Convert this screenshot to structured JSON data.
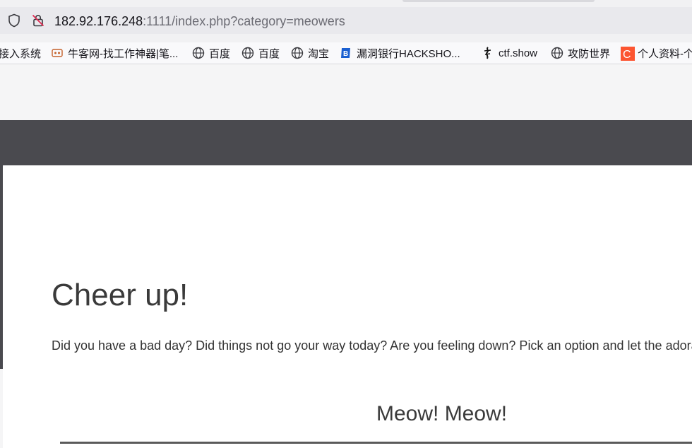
{
  "browser": {
    "url_host": "182.92.176.248",
    "url_rest": ":1111/index.php?category=meowers"
  },
  "bookmarks": [
    {
      "label": "接入系统",
      "icon": "none"
    },
    {
      "label": "牛客网-找工作神器|笔...",
      "icon": "nowcoder-icon"
    },
    {
      "label": "百度",
      "icon": "globe-icon"
    },
    {
      "label": "百度",
      "icon": "globe-icon"
    },
    {
      "label": "淘宝",
      "icon": "globe-icon"
    },
    {
      "label": "漏洞银行HACKSHO...",
      "icon": "bugbank-icon"
    },
    {
      "label": "ctf.show",
      "icon": "ctfshow-icon"
    },
    {
      "label": "攻防世界",
      "icon": "globe-icon"
    },
    {
      "label": "个人资料-个",
      "icon": "csdn-icon"
    }
  ],
  "page": {
    "heading": "Cheer up!",
    "paragraph": "Did you have a bad day? Did things not go your way today? Are you feeling down? Pick an option and let the adorable",
    "subheading": "Meow! Meow!"
  },
  "colors": {
    "dark_band": "#4a4a4f",
    "card": "#ffffff",
    "csdn": "#fc5531",
    "bugbank": "#1a5fd1"
  }
}
